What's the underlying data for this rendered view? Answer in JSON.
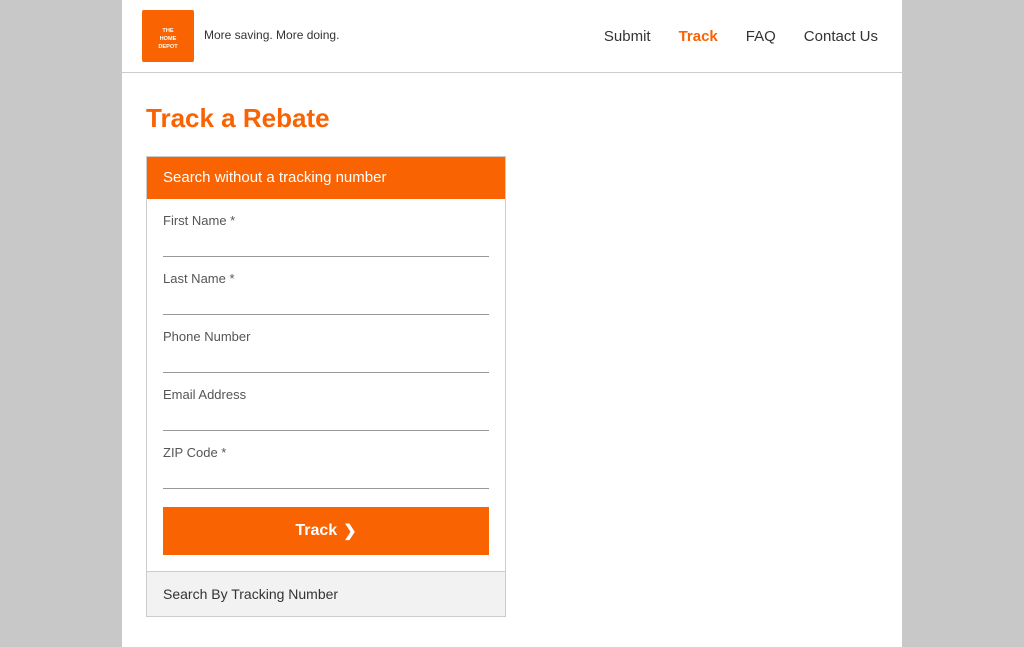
{
  "header": {
    "tagline": "More saving. More doing.",
    "nav": [
      {
        "label": "Submit",
        "active": false
      },
      {
        "label": "Track",
        "active": true
      },
      {
        "label": "FAQ",
        "active": false
      },
      {
        "label": "Contact Us",
        "active": false
      }
    ]
  },
  "main": {
    "page_title": "Track a Rebate",
    "panel": {
      "header_text": "Search without a tracking number",
      "fields": [
        {
          "label": "First Name *",
          "placeholder": "",
          "name": "first-name-input"
        },
        {
          "label": "Last Name *",
          "placeholder": "",
          "name": "last-name-input"
        },
        {
          "label": "Phone Number",
          "placeholder": "",
          "name": "phone-number-input"
        },
        {
          "label": "Email Address",
          "placeholder": "",
          "name": "email-address-input"
        },
        {
          "label": "ZIP Code *",
          "placeholder": "",
          "name": "zip-code-input"
        }
      ],
      "track_button_label": "Track",
      "chevron": "❯",
      "alt_search_label": "Search By Tracking Number"
    }
  }
}
